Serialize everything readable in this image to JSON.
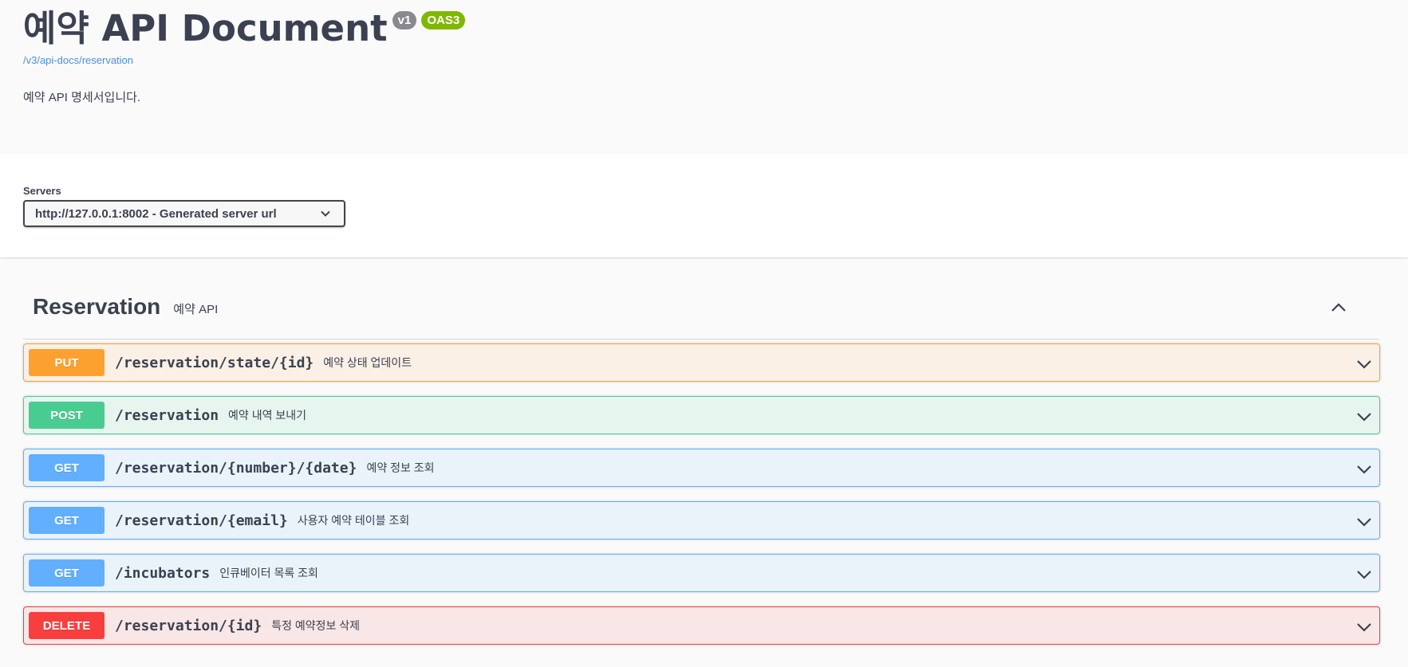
{
  "info": {
    "title": "예약 API Document",
    "version_badge": "v1",
    "oas_badge": "OAS3",
    "spec_url": "/v3/api-docs/reservation",
    "description": "예약 API 명세서입니다."
  },
  "servers": {
    "label": "Servers",
    "selected": "http://127.0.0.1:8002 - Generated server url"
  },
  "tag": {
    "name": "Reservation",
    "description": "예약 API"
  },
  "operations": [
    {
      "method": "PUT",
      "path": "/reservation/state/{id}",
      "summary": "예약 상태 업데이트"
    },
    {
      "method": "POST",
      "path": "/reservation",
      "summary": "예약 내역 보내기"
    },
    {
      "method": "GET",
      "path": "/reservation/{number}/{date}",
      "summary": "예약 정보 조회"
    },
    {
      "method": "GET",
      "path": "/reservation/{email}",
      "summary": "사용자 예약 테이블 조회"
    },
    {
      "method": "GET",
      "path": "/incubators",
      "summary": "인큐베이터 목록 조회"
    },
    {
      "method": "DELETE",
      "path": "/reservation/{id}",
      "summary": "특정 예약정보 삭제"
    }
  ],
  "colors": {
    "put": "#fca130",
    "post": "#49cc90",
    "get": "#61affe",
    "delete": "#f93e3e"
  }
}
